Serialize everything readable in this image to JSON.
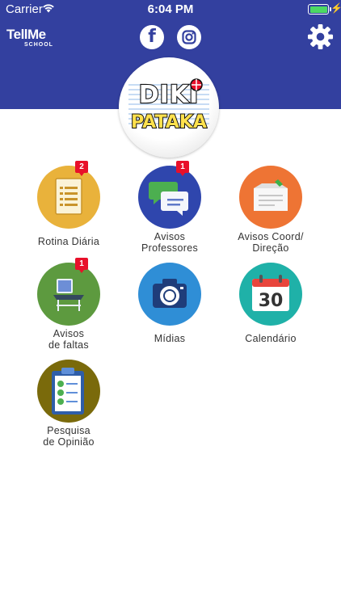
{
  "status_bar": {
    "carrier": "Carrier",
    "time": "6:04 PM"
  },
  "header": {
    "app_logo_main": "TellMe",
    "app_logo_sub": "SCHOOL",
    "facebook_icon": "facebook-icon",
    "instagram_icon": "instagram-icon",
    "settings_icon": "gear-icon",
    "school_logo_line1": "DIKI",
    "school_logo_line2": "PATAKA",
    "colors": {
      "header_bg": "#33409f"
    }
  },
  "menu": [
    {
      "label": "Rotina Diária",
      "icon": "checklist-document-icon",
      "color": "#e9b23b",
      "badge": "2"
    },
    {
      "label": "Avisos\nProfessores",
      "icon": "chat-bubbles-icon",
      "color": "#2f46ad",
      "badge": "1"
    },
    {
      "label": "Avisos Coord/\nDireção",
      "icon": "notice-envelope-icon",
      "color": "#ee7434",
      "badge": ""
    },
    {
      "label": "Avisos\nde faltas",
      "icon": "school-desk-icon",
      "color": "#5d9a3f",
      "badge": "1"
    },
    {
      "label": "Mídias",
      "icon": "camera-icon",
      "color": "#2f8ed6",
      "badge": ""
    },
    {
      "label": "Calendário",
      "icon": "calendar-icon",
      "color": "#1fb1a8",
      "badge": ""
    },
    {
      "label": "Pesquisa\nde Opinião",
      "icon": "survey-clipboard-icon",
      "color": "#7a6a0b",
      "badge": ""
    }
  ],
  "calendar_day": "30"
}
